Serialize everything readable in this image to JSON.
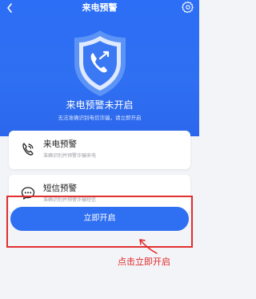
{
  "header": {
    "title": "来电预警",
    "back_icon": "chevron-left-icon",
    "settings_icon": "gear-icon"
  },
  "status": {
    "title": "来电预警未开启",
    "subtitle": "无法准确识别电信诈骗，请立即开启"
  },
  "features": [
    {
      "name": "来电预警",
      "desc": "准确识别并预警诈骗来电",
      "icon": "phone-icon"
    },
    {
      "name": "短信预警",
      "desc": "准确识别并预警诈骗短信",
      "icon": "sms-icon"
    }
  ],
  "action": {
    "label": "立即开启"
  },
  "annotation": {
    "text": "点击立即开启"
  },
  "colors": {
    "primary": "#2f6ff2",
    "annotation_red": "#e02828",
    "background": "#f3f4f8"
  }
}
